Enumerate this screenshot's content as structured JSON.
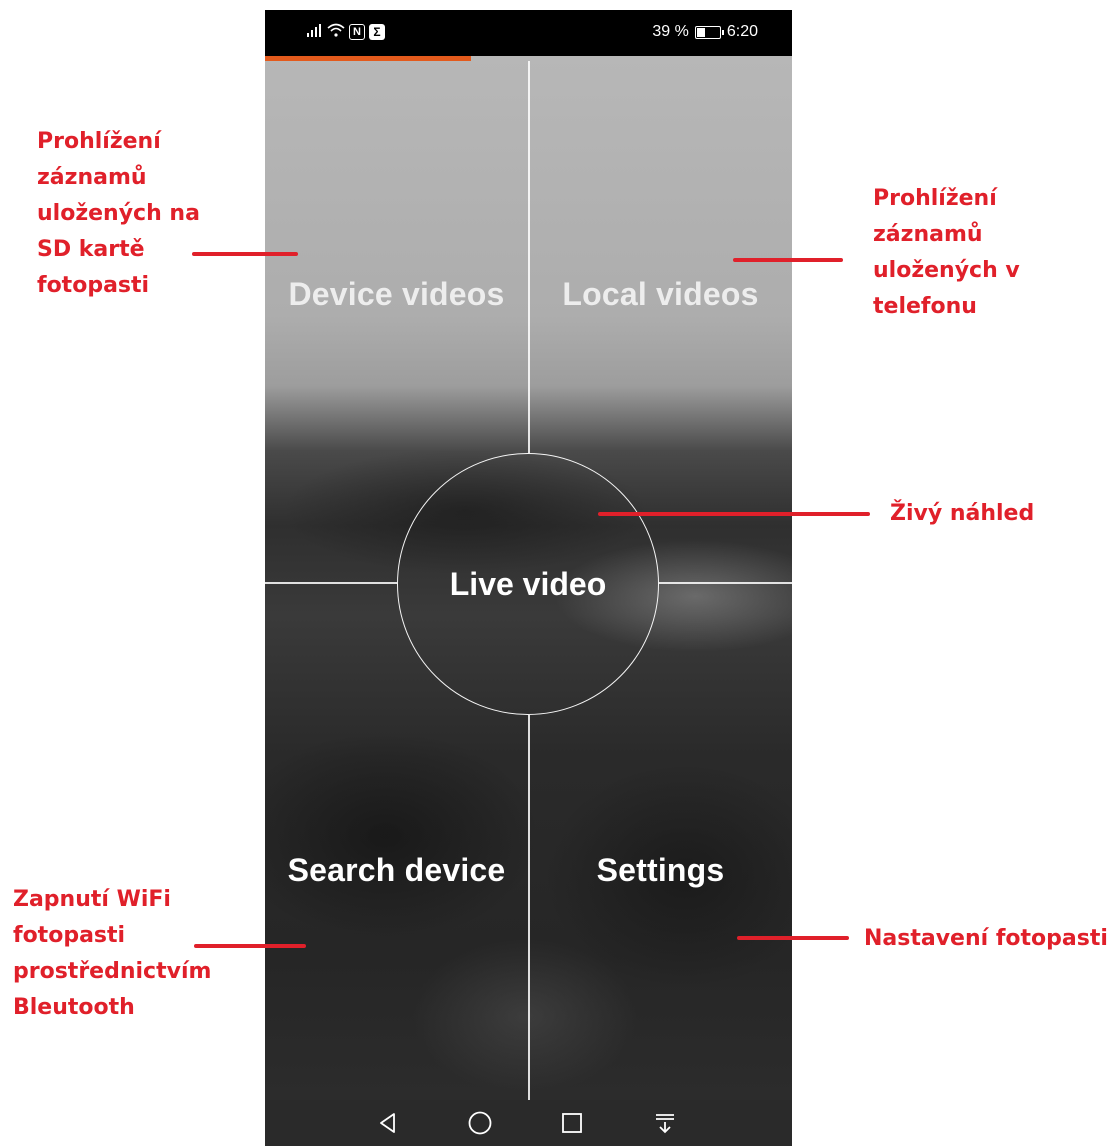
{
  "status_bar": {
    "battery_text": "39 %",
    "time": "6:20",
    "battery_level": 0.39,
    "icons": [
      "signal-icon",
      "wifi-icon",
      "nfc-icon",
      "sigma-icon"
    ]
  },
  "page_progress": 0.39,
  "tiles": {
    "device_videos": "Device videos",
    "local_videos": "Local videos",
    "live_video": "Live video",
    "search_device": "Search device",
    "settings": "Settings"
  },
  "annotations": {
    "sd_card": [
      "Prohlížení",
      "záznamů",
      "uložených na",
      "SD kartě",
      "fotopasti"
    ],
    "phone": [
      "Prohlížení",
      "záznamů",
      "uložených v",
      "telefonu"
    ],
    "live": [
      "Živý náhled"
    ],
    "wifi": [
      "Zapnutí WiFi",
      "fotopasti",
      "prostřednictvím",
      "Bleutooth"
    ],
    "settings": [
      "Nastavení fotopasti"
    ]
  },
  "nav": [
    "back-icon",
    "home-icon",
    "recents-icon",
    "notifications-down-icon"
  ],
  "colors": {
    "annotation": "#e0202a",
    "progress": "#e35a1c",
    "status_bar": "#000000",
    "nav_bar": "#2a2a2a"
  }
}
